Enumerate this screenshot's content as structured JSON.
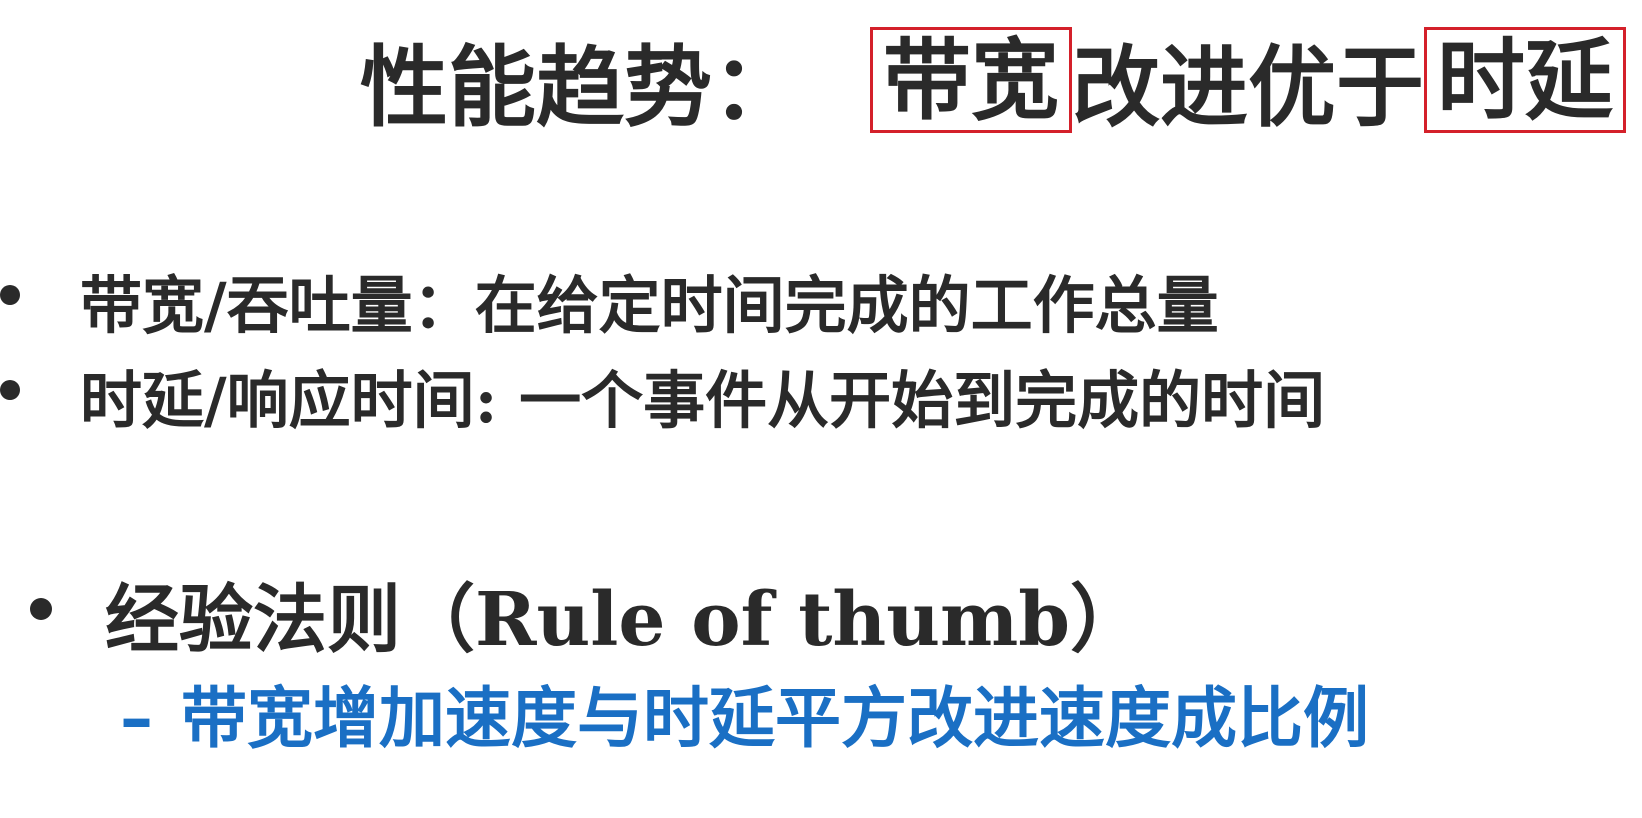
{
  "title": {
    "part1": "性能趋势：",
    "boxed1": "带宽",
    "part2": "改进优于",
    "boxed2": "时延"
  },
  "bullets": [
    {
      "text": "带宽/吞吐量：在给定时间完成的工作总量"
    },
    {
      "text": "时延/响应时间: 一个事件从开始到完成的时间"
    }
  ],
  "rule": {
    "text": "经验法则（Rule of thumb）",
    "sub_dash": "–",
    "sub_text": "带宽增加速度与时延平方改进速度成比例"
  },
  "colors": {
    "text": "#2a2a2a",
    "highlight_box": "#d4202a",
    "sub_point": "#1a6fc4"
  }
}
